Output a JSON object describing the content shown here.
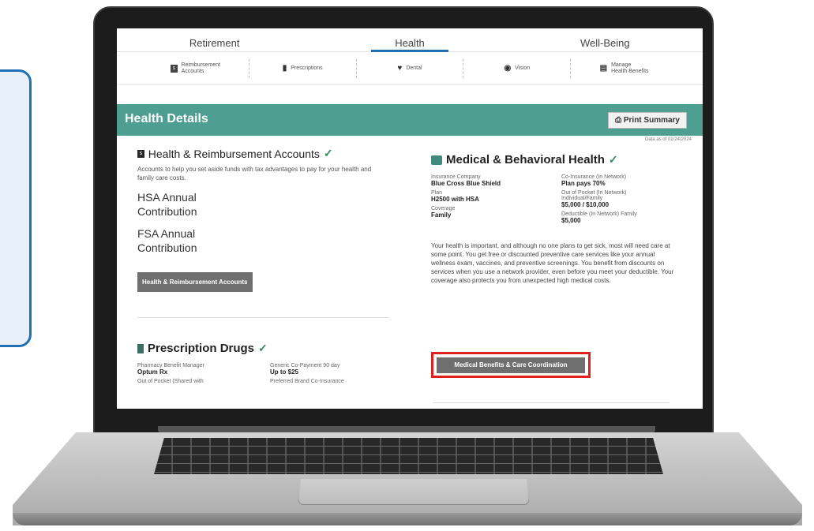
{
  "tabs": [
    "Retirement",
    "Health",
    "Well-Being"
  ],
  "subnav": [
    {
      "label_top": "Reimbursement",
      "label_bottom": "Accounts",
      "icon": "card-icon"
    },
    {
      "label_top": "Prescriptions",
      "label_bottom": "",
      "icon": "pill-bottle-icon"
    },
    {
      "label_top": "Dental",
      "label_bottom": "",
      "icon": "tooth-icon"
    },
    {
      "label_top": "Vision",
      "label_bottom": "",
      "icon": "eye-icon"
    },
    {
      "label_top": "Manage",
      "label_bottom": "Health Benefits",
      "icon": "document-icon"
    }
  ],
  "banner": {
    "title": "Health Details",
    "print_label": "Print Summary",
    "date_as_of": "Data as of 01/24/2024"
  },
  "hra": {
    "title": "Health & Reimbursement Accounts",
    "desc": "Accounts to help you set aside funds with tax advantages to pay for your health and family care costs.",
    "hsa_line1": "HSA Annual",
    "hsa_line2": "Contribution",
    "fsa_line1": "FSA Annual",
    "fsa_line2": "Contribution",
    "button": "Health & Reimbursement Accounts"
  },
  "rx": {
    "title": "Prescription Drugs",
    "pbm_label": "Pharmacy Benefit Manager",
    "pbm_value": "Optum Rx",
    "oop_label": "Out of Pocket (Shared with",
    "generic_label": "Generic Co-Payment 90 day",
    "generic_value": "Up to $25",
    "preferred_label": "Preferred Brand Co-Insurance"
  },
  "medical": {
    "title": "Medical & Behavioral Health",
    "insurance_label": "Insurance Company",
    "insurance_value": "Blue Cross Blue Shield",
    "plan_label": "Plan",
    "plan_value": "H2500 with HSA",
    "coverage_label": "Coverage",
    "coverage_value": "Family",
    "coins_label": "Co-Insurance (In Network)",
    "coins_value": "Plan pays 70%",
    "oop_label": "Out of Pocket (In Network)",
    "oop_sub": "Individual/Family",
    "oop_value": "$5,000 / $10,000",
    "deduct_label": "Deductible (In Network) Family",
    "deduct_value": "$5,000",
    "paragraph": "Your health is important, and although no one plans to get sick, most will need care at some point. You get free or discounted preventive care services like your annual wellness exam, vaccines, and preventive screenings. You benefit from discounts on services when you use a network provider, even before you meet your deductible. Your coverage also protects you from unexpected high medical costs.",
    "button": "Medical Benefits & Care Coordination"
  }
}
